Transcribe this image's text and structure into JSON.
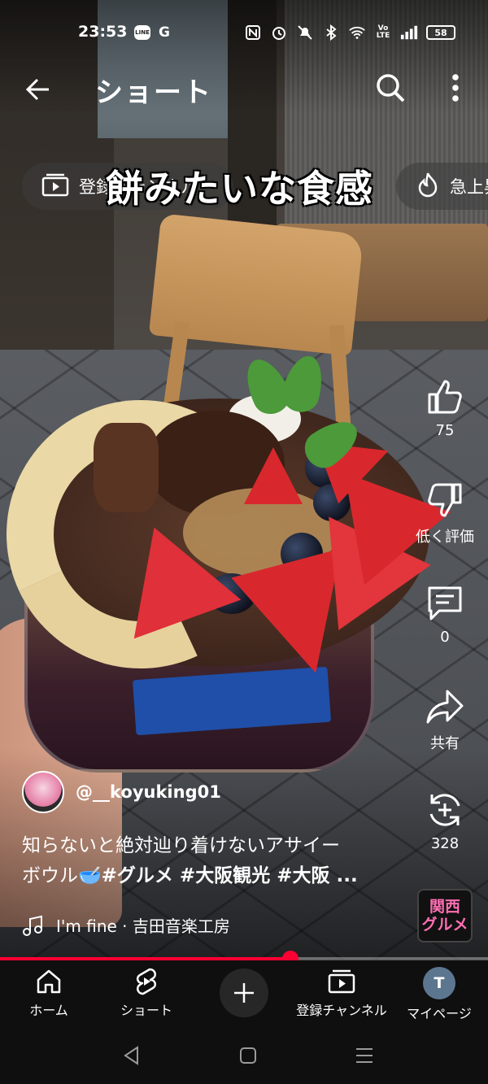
{
  "status_bar": {
    "time": "23:53",
    "apps": [
      "LINE",
      "G"
    ],
    "battery": "58"
  },
  "header": {
    "title": "ショート"
  },
  "chips": {
    "subscriptions": "登録チャンネル",
    "trending": "急上昇"
  },
  "video": {
    "overlay_caption": "餅みたいな食感"
  },
  "actions": {
    "like_count": "75",
    "dislike_label": "低く評価",
    "comment_count": "0",
    "share_label": "共有",
    "remix_count": "328"
  },
  "info": {
    "channel_handle": "@__koyuking01",
    "description_line1": "知らないと絶対辿り着けないアサイー",
    "description_line2_plain": "ボウル",
    "description_emoji": "🥣",
    "description_tags": "#グルメ #大阪観光 #大阪 ...",
    "music": "I'm fine · 吉田音楽工房",
    "badge_line1": "関西",
    "badge_line2": "グルメ"
  },
  "progress": {
    "fraction": 0.595,
    "color": "#ff0033"
  },
  "nav": {
    "home": "ホーム",
    "shorts": "ショート",
    "subscriptions": "登録チャンネル",
    "mypage": "マイページ",
    "user_initial": "T"
  }
}
